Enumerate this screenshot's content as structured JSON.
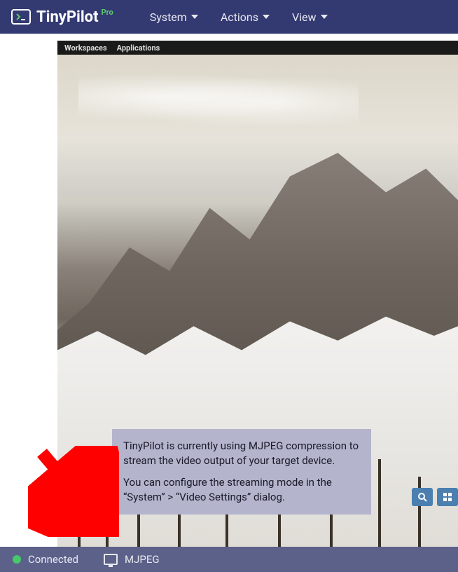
{
  "topbar": {
    "logo_text": "TinyPilot",
    "logo_badge": "Pro",
    "nav": [
      {
        "label": "System"
      },
      {
        "label": "Actions"
      },
      {
        "label": "View"
      }
    ]
  },
  "remote": {
    "menu": [
      {
        "label": "Workspaces"
      },
      {
        "label": "Applications"
      }
    ]
  },
  "tooltip": {
    "line1": "TinyPilot is currently using MJPEG compression to stream the video output of your target device.",
    "line2": "You can configure the streaming mode in the “System” > “Video Settings” dialog."
  },
  "status": {
    "connection": "Connected",
    "stream_mode": "MJPEG"
  }
}
